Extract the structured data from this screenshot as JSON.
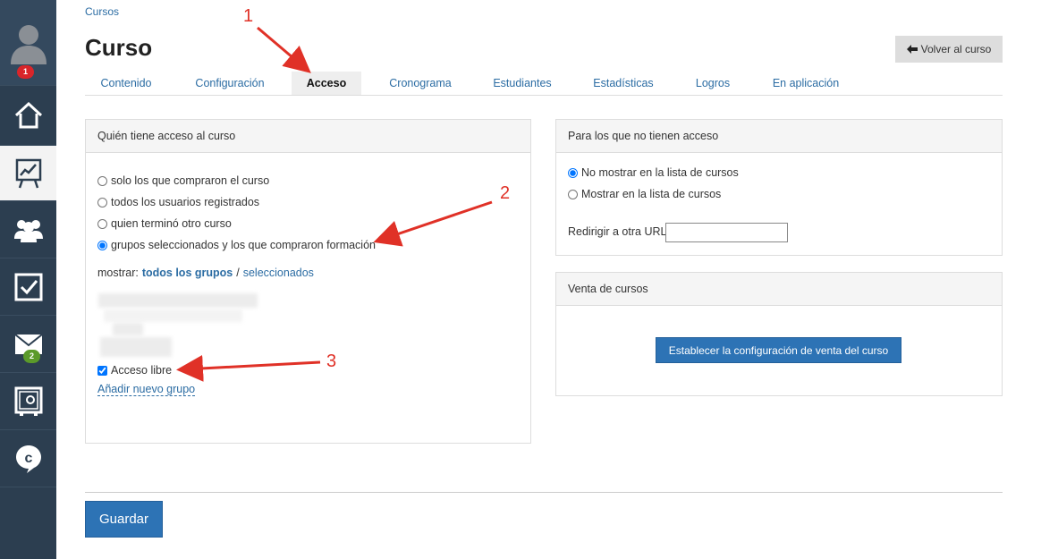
{
  "sidebar": {
    "notifications_badge": "1",
    "messages_badge": "2",
    "items": [
      {
        "name": "user-avatar-icon"
      },
      {
        "name": "home-icon"
      },
      {
        "name": "courses-chart-icon",
        "active": true
      },
      {
        "name": "users-group-icon"
      },
      {
        "name": "checkbox-tasks-icon"
      },
      {
        "name": "mail-icon"
      },
      {
        "name": "safe-icon"
      },
      {
        "name": "chat-logo-icon"
      }
    ]
  },
  "breadcrumb": "Cursos",
  "page_title": "Curso",
  "back_button": "Volver al curso",
  "tabs": [
    "Contenido",
    "Configuración",
    "Acceso",
    "Cronograma",
    "Estudiantes",
    "Estadísticas",
    "Logros",
    "En aplicación"
  ],
  "active_tab": "Acceso",
  "access_panel": {
    "title": "Quién tiene acceso al curso",
    "options": [
      {
        "label": "solo los que compraron el curso",
        "checked": false
      },
      {
        "label": "todos los usuarios registrados",
        "checked": false
      },
      {
        "label": "quien terminó otro curso",
        "checked": false
      },
      {
        "label": "grupos seleccionados y los que compraron formación",
        "checked": true
      }
    ],
    "show_label": "mostrar:",
    "show_all": "todos los grupos",
    "separator": "/",
    "show_selected": "seleccionados",
    "free_access": "Acceso libre",
    "free_access_checked": true,
    "add_group": "Añadir nuevo grupo"
  },
  "no_access_panel": {
    "title": "Para los que no tienen acceso",
    "options": [
      {
        "label": "No mostrar en la lista de cursos",
        "checked": true
      },
      {
        "label": "Mostrar en la lista de cursos",
        "checked": false
      }
    ],
    "redirect_label": "Redirigir a otra URL",
    "redirect_value": ""
  },
  "sale_panel": {
    "title": "Venta de cursos",
    "button": "Establecer la configuración de venta del curso"
  },
  "save_button": "Guardar",
  "annotations": [
    "1",
    "2",
    "3"
  ],
  "colors": {
    "sidebar": "#2c3e50",
    "link": "#2b6ca3",
    "primary": "#2d73b5",
    "annotation": "#e03127",
    "badge_red": "#d9252a",
    "badge_green": "#5b9a2a"
  }
}
